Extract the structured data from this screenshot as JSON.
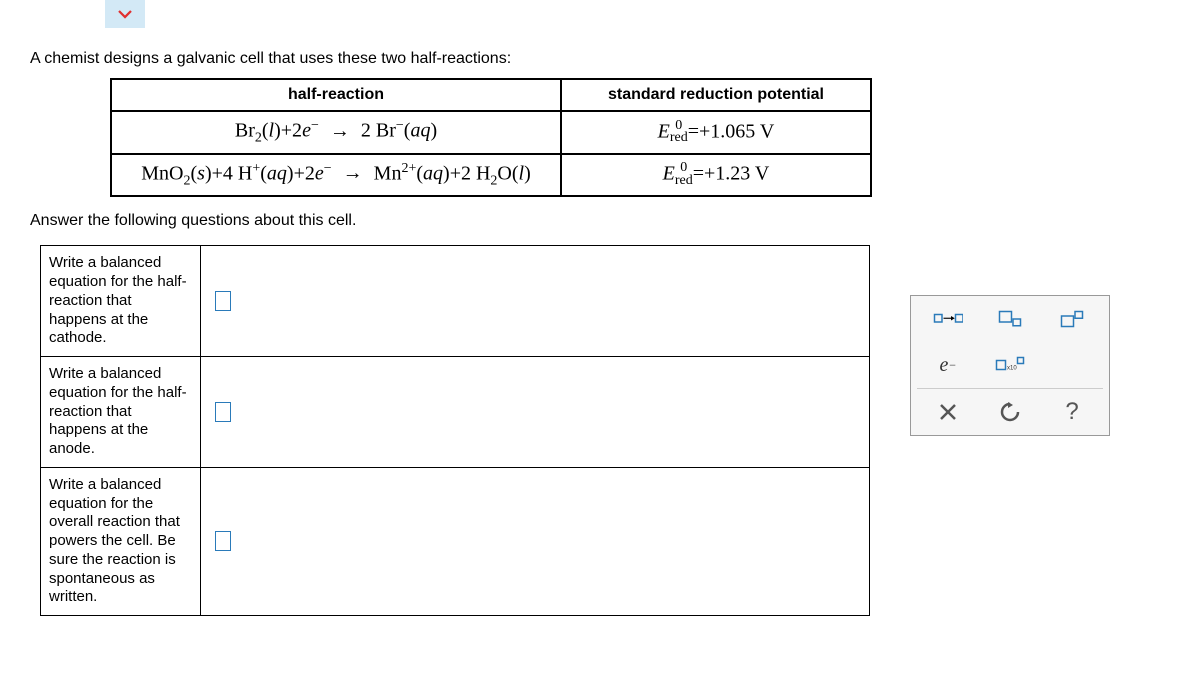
{
  "intro": "A chemist designs a galvanic cell that uses these two half-reactions:",
  "table": {
    "headers": {
      "c1": "half-reaction",
      "c2": "standard reduction potential"
    },
    "rows": [
      {
        "reaction_html": "Br<sub>2</sub>(<span class='it'>l</span>)+2<span class='it'>e</span><sup>&#8722;</sup> <span class='arrow'>&#8594;</span> 2 Br<sup>&#8722;</sup>(<span class='it'>aq</span>)",
        "potential_html": "<span class='it'>E</span><span style='display:inline-block;vertical-align:-4px;font-size:0.7em;line-height:0.9'><span style='display:block'>0</span><span style='display:block'>red</span></span>=+1.065 V"
      },
      {
        "reaction_html": "MnO<sub>2</sub>(<span class='it'>s</span>)+4 H<sup>+</sup>(<span class='it'>aq</span>)+2<span class='it'>e</span><sup>&#8722;</sup> <span class='arrow'>&#8594;</span> Mn<sup>2+</sup>(<span class='it'>aq</span>)+2 H<sub>2</sub>O(<span class='it'>l</span>)",
        "potential_html": "<span class='it'>E</span><span style='display:inline-block;vertical-align:-4px;font-size:0.7em;line-height:0.9'><span style='display:block'>0</span><span style='display:block'>red</span></span>=+1.23 V"
      }
    ]
  },
  "after": "Answer the following questions about this cell.",
  "answers": {
    "p1": "Write a balanced equation for the half-reaction that happens at the cathode.",
    "p2": "Write a balanced equation for the half-reaction that happens at the anode.",
    "p3": "Write a balanced equation for the overall reaction that powers the cell. Be sure the reaction is spontaneous as written."
  },
  "tools": {
    "arrow_btn": "reaction-arrow",
    "state_btn": "state-subscript",
    "superscript_btn": "superscript",
    "electron_btn": "electron",
    "sci_btn": "scientific-notation",
    "close_btn": "close",
    "reset_btn": "reset",
    "help_btn": "help"
  }
}
